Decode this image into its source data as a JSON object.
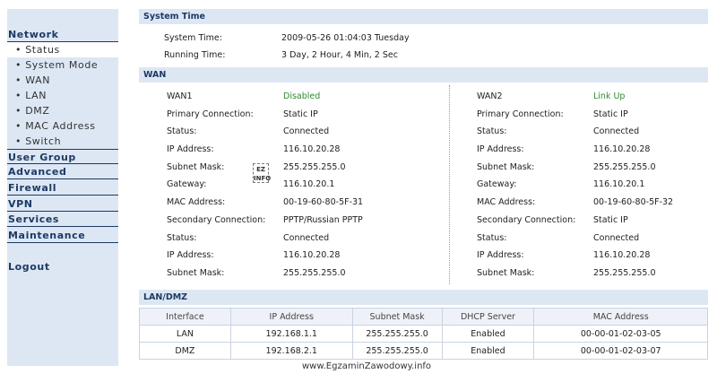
{
  "sidebar": {
    "network": "Network",
    "network_items": [
      "Status",
      "System Mode",
      "WAN",
      "LAN",
      "DMZ",
      "MAC Address",
      "Switch"
    ],
    "bullet": "•",
    "sections": [
      "User Group",
      "Advanced",
      "Firewall",
      "VPN",
      "Services",
      "Maintenance"
    ],
    "logout": "Logout"
  },
  "system_time": {
    "title": "System Time",
    "system_time_label": "System Time:",
    "system_time_value": "2009-05-26 01:04:03 Tuesday",
    "running_time_label": "Running Time:",
    "running_time_value": "3 Day, 2 Hour, 4 Min, 2 Sec"
  },
  "wan": {
    "title": "WAN",
    "wan1": {
      "name": "WAN1",
      "state": "Disabled",
      "primary_connection": "Static IP",
      "status": "Connected",
      "ip": "116.10.20.28",
      "subnet": "255.255.255.0",
      "gateway": "116.10.20.1",
      "mac": "00-19-60-80-5F-31",
      "secondary_connection": "PPTP/Russian PPTP",
      "secondary_status": "Connected",
      "secondary_ip": "116.10.20.28",
      "secondary_subnet": "255.255.255.0"
    },
    "wan2": {
      "name": "WAN2",
      "state": "Link Up",
      "primary_connection": "Static IP",
      "status": "Connected",
      "ip": "116.10.20.28",
      "subnet": "255.255.255.0",
      "gateway": "116.10.20.1",
      "mac": "00-19-60-80-5F-32",
      "secondary_connection": "Static IP",
      "secondary_status": "Connected",
      "secondary_ip": "116.10.20.28",
      "secondary_subnet": "255.255.255.0"
    },
    "labels": {
      "primary_connection": "Primary Connection:",
      "status": "Status:",
      "ip": "IP Address:",
      "subnet": "Subnet Mask:",
      "gateway": "Gateway:",
      "mac": "MAC Address:",
      "secondary_connection": "Secondary Connection:"
    },
    "logo_line1": "EZ",
    "logo_line2": "INFO"
  },
  "lan_dmz": {
    "title": "LAN/DMZ",
    "columns": [
      "Interface",
      "IP Address",
      "Subnet Mask",
      "DHCP Server",
      "MAC Address"
    ],
    "rows": [
      [
        "LAN",
        "192.168.1.1",
        "255.255.255.0",
        "Enabled",
        "00-00-01-02-03-05"
      ],
      [
        "DMZ",
        "192.168.2.1",
        "255.255.255.0",
        "Enabled",
        "00-00-01-02-03-07"
      ]
    ]
  },
  "footer": "www.EgzaminZawodowy.info",
  "colors": {
    "accent": "#1c3a63",
    "panel_bg": "#dde7f4",
    "status_green": "#2e8b2e"
  }
}
